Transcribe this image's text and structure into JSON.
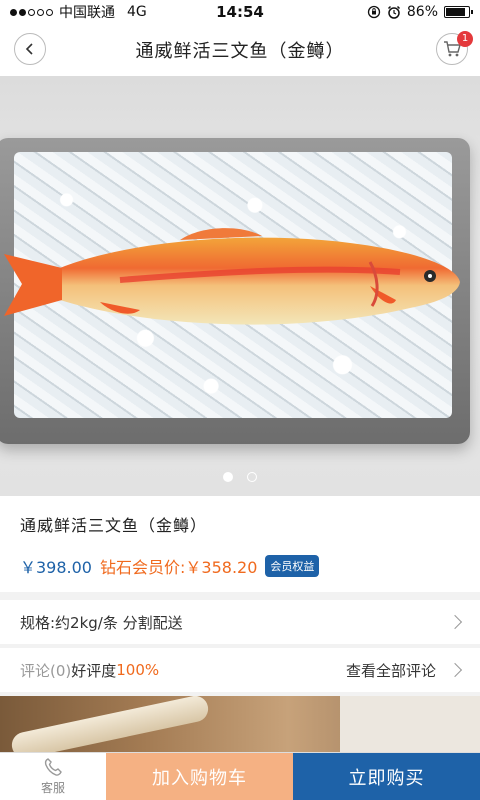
{
  "status_bar": {
    "carrier": "中国联通",
    "network": "4G",
    "time": "14:54",
    "battery": "86%",
    "battery_level": 0.86,
    "signal_bars": 2
  },
  "nav": {
    "title": "通威鲜活三文鱼（金鳟）",
    "back_icon": "chevron-left-icon",
    "cart_icon": "cart-icon",
    "cart_count": "1"
  },
  "gallery": {
    "image_count": 2,
    "active_index": 0
  },
  "product": {
    "name": "通威鲜活三文鱼（金鳟）",
    "price": "￥398.00",
    "vip_price_label": "钻石会员价:",
    "vip_price": "￥358.20",
    "member_tag": "会员权益"
  },
  "spec": {
    "label": "规格:约2kg/条 分割配送"
  },
  "reviews": {
    "label": "评论(0)",
    "rate_label": "好评度",
    "rate_value": "100%",
    "view_all": "查看全部评论"
  },
  "bottom_bar": {
    "service_label": "客服",
    "service_icon": "phone-icon",
    "add_to_cart": "加入购物车",
    "buy_now": "立即购买"
  },
  "colors": {
    "primary_blue": "#1e62a8",
    "accent_orange": "#f06a1e",
    "cart_button": "#f5b183",
    "badge_red": "#e4393c"
  }
}
